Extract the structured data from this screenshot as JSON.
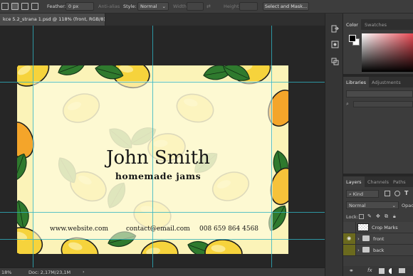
{
  "options_bar": {
    "feather_label": "Feather:",
    "feather_value": "0 px",
    "antialias_label": "Anti-alias",
    "style_label": "Style:",
    "style_value": "Normal",
    "width_label": "Width:",
    "height_label": "Height:",
    "select_mask_label": "Select and Mask..."
  },
  "document": {
    "tab_title": "kce 5.2_strana 1.psd @ 118% (front, RGB/8)"
  },
  "card": {
    "name": "John Smith",
    "tagline": "homemade jams",
    "website": "www.website.com",
    "email": "contact@email.com",
    "phone": "008 659 864 4568"
  },
  "status_bar": {
    "zoom": "18%",
    "doc_info": "Doc: 2,17M/23,1M"
  },
  "panels": {
    "color_tabs": [
      "Color",
      "Swatches"
    ],
    "library_tabs": [
      "Libraries",
      "Adjustments"
    ],
    "layer_tabs": [
      "Layers",
      "Channels",
      "Paths"
    ],
    "kind_filter": "Kind",
    "blend_mode": "Normal",
    "opacity_label": "Opacit",
    "lock_label": "Lock:",
    "layers": [
      {
        "name": "Crop Marks",
        "type": "layer"
      },
      {
        "name": "front",
        "type": "group"
      },
      {
        "name": "back",
        "type": "group"
      }
    ]
  },
  "colors": {
    "accent_guide": "#2fb3c2",
    "card_bg": "#fbf3b8",
    "lemon": "#f6d33c",
    "leaf": "#2f7a2e",
    "layer_visibility": "#6b6a1e"
  }
}
